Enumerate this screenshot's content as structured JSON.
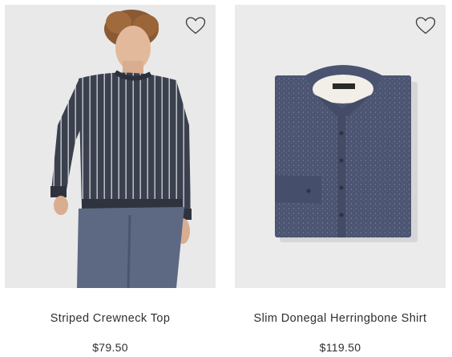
{
  "products": [
    {
      "name": "Striped Crewneck Top",
      "price": "$79.50",
      "image_icon": "model-striped-sweater-image",
      "wishlist_icon": "heart-outline-icon"
    },
    {
      "name": "Slim Donegal Herringbone Shirt",
      "price": "$119.50",
      "image_icon": "folded-shirt-image",
      "wishlist_icon": "heart-outline-icon"
    }
  ],
  "colors": {
    "image_background": "#e9e9ea",
    "text": "#2f2f2f",
    "sweater": "#3c4150",
    "pants": "#5b6780",
    "shirt": "#4d5672"
  }
}
